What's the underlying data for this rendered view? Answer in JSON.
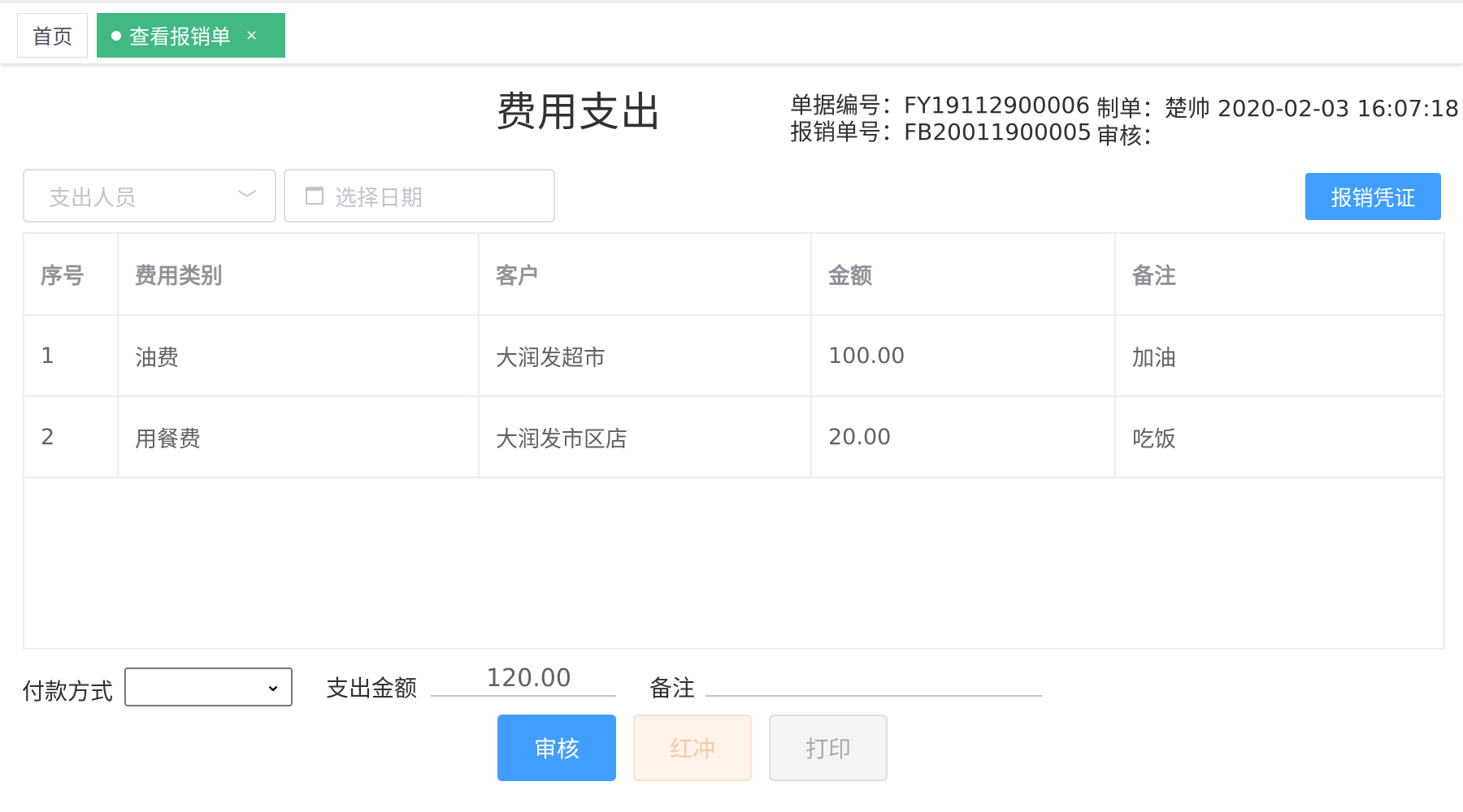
{
  "tabs": {
    "home": "首页",
    "active": "查看报销单",
    "close": "×"
  },
  "header": {
    "title": "费用支出",
    "doc_no": "单据编号：FY19112900006",
    "reimburse_no": "报销单号：FB20011900005",
    "maker": "制单：楚帅 2020-02-03 16:07:18",
    "auditor": "审核："
  },
  "filters": {
    "person_placeholder": "支出人员",
    "date_placeholder": "选择日期",
    "voucher_button": "报销凭证"
  },
  "table": {
    "columns": [
      "序号",
      "费用类别",
      "客户",
      "金额",
      "备注"
    ],
    "rows": [
      [
        "1",
        "油费",
        "大润发超市",
        "100.00",
        "加油"
      ],
      [
        "2",
        "用餐费",
        "大润发市区店",
        "20.00",
        "吃饭"
      ]
    ]
  },
  "footer": {
    "pay_method_label": "付款方式",
    "pay_method_value": "",
    "amount_label": "支出金额",
    "amount_value": "120.00",
    "remark_label": "备注",
    "remark_value": ""
  },
  "buttons": {
    "audit": "审核",
    "reverse": "红冲",
    "print": "打印"
  }
}
